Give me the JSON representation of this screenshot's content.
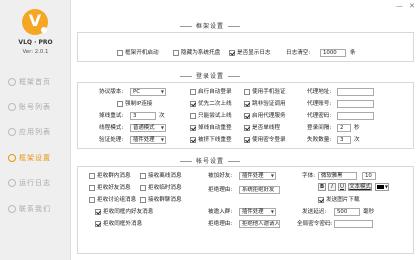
{
  "app": {
    "logo_letter": "V",
    "name": "VLQ · PRO",
    "version": "Ver: 2.0.1"
  },
  "window": {
    "minimize": "—",
    "close": "✕"
  },
  "sidebar": {
    "items": [
      {
        "label": "框架首页"
      },
      {
        "label": "账号列表"
      },
      {
        "label": "应用列表"
      },
      {
        "label": "框架设置"
      },
      {
        "label": "运行日志"
      },
      {
        "label": "联系我们"
      }
    ]
  },
  "sections": {
    "basic": {
      "title": "框架设置",
      "autostart": "框架开机启动",
      "tray": "隐藏为系统托盘",
      "show_log": "是否显示日志",
      "log_clear_label": "日志清空:",
      "log_clear_value": "1000",
      "log_clear_unit": "条"
    },
    "login": {
      "title": "登录设置",
      "protocol_label": "协议版本:",
      "protocol_value": "PC",
      "force_ip": "强制IP连接",
      "relogin_label": "掉线重试:",
      "relogin_value": "3",
      "relogin_unit": "次",
      "thread_label": "线程模式:",
      "thread_value": "普通模式",
      "verify_label": "验证处理:",
      "verify_value": "插件处理",
      "auto_login": "启行自动登录",
      "priority_online": "优先二次上线",
      "only_online": "只能尝试上线",
      "auto_relogin": "掉线自动重登",
      "rerun_login": "被挤下线重登",
      "phone_verify": "使用手机验证",
      "skip_verify": "跳非验证调用",
      "enable_proxy": "启用代理服务",
      "proxy_thread": "是否单线程",
      "use_proxy_login": "使用密令登录",
      "proxy_name": "代理地址:",
      "proxy_account": "代理账号:",
      "proxy_password": "代理密码:",
      "login_interval": "登录间隔:",
      "login_interval_value": "2",
      "login_interval_unit": "秒",
      "fail_count": "失败数量:",
      "fail_count_value": "3",
      "fail_count_unit": "次"
    },
    "account": {
      "title": "帐号设置",
      "c1": [
        "拒收群内消息",
        "拒收好友消息",
        "拒收讨论组消息",
        "拒收同框内好友消息",
        "拒收同框外消息"
      ],
      "c2": [
        "接收离线消息",
        "拒收临时消息",
        "接收群聊消息"
      ],
      "add_friend_label": "被加好友:",
      "add_friend_value": "插件处理",
      "reject_reason_label": "拒绝理由:",
      "reject_reason_value": "系统拒绝好友",
      "group_invite_label": "被邀入群:",
      "group_invite_value": "插件处理",
      "reject_reason2_label": "拒绝理由:",
      "reject_reason2_value": "拒绝他人邀请入群",
      "font_label": "字体:",
      "font_value": "微软雅黑",
      "font_size": "10",
      "bold": "B",
      "italic": "I",
      "underline": "U",
      "style_label": "文本模式",
      "send_image": "发送图片下载",
      "send_interval_label": "发送延迟:",
      "send_interval_value": "500",
      "send_interval_unit": "毫秒",
      "global_password_label": "全局密令密码:"
    }
  },
  "colors": {
    "accent": "#e8960c",
    "logo": "#f5a623"
  }
}
